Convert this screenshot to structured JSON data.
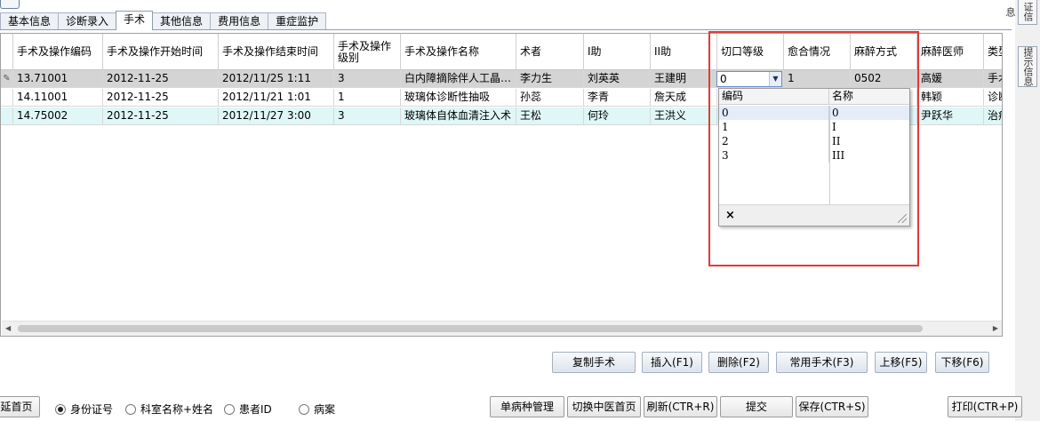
{
  "tabs": [
    {
      "label": "基本信息"
    },
    {
      "label": "诊断录入"
    },
    {
      "label": "手术",
      "active": true
    },
    {
      "label": "其他信息"
    },
    {
      "label": "费用信息"
    },
    {
      "label": "重症监护"
    }
  ],
  "side_tabs": [
    "证信息",
    "提示信息",
    "提示信息"
  ],
  "grid": {
    "columns": [
      "手术及操作编码",
      "手术及操作开始时间",
      "手术及操作结束时间",
      "手术及操作级别",
      "手术及操作名称",
      "术者",
      "I助",
      "II助",
      "切口等级",
      "愈合情况",
      "麻醉方式",
      "麻醉医师",
      "类型"
    ],
    "rows": [
      {
        "cells": [
          "13.71001",
          "2012-11-25",
          "2012/11/25 1:11",
          "3",
          "白内障摘除伴人工晶…",
          "李力生",
          "刘英英",
          "王建明",
          "0",
          "1",
          "0502",
          "高媛",
          "手术"
        ],
        "editing": true
      },
      {
        "cells": [
          "14.11001",
          "2012-11-25",
          "2012/11/21 1:01",
          "1",
          "玻璃体诊断性抽吸",
          "孙蕊",
          "李青",
          "詹天成",
          "",
          "",
          "",
          "韩颖",
          "诊断"
        ]
      },
      {
        "cells": [
          "14.75002",
          "2012-11-25",
          "2012/11/27 3:00",
          "3",
          "玻璃体自体血清注入术",
          "王松",
          "何玲",
          "王洪义",
          "",
          "",
          "",
          "尹跃华",
          "治疗"
        ]
      }
    ]
  },
  "editor": {
    "value": "0"
  },
  "dropdown": {
    "headers": [
      "编码",
      "名称"
    ],
    "items": [
      {
        "code": "0",
        "name": "0"
      },
      {
        "code": "1",
        "name": "I"
      },
      {
        "code": "2",
        "name": "II"
      },
      {
        "code": "3",
        "name": "III"
      }
    ],
    "close": "×"
  },
  "actions": {
    "copy": "复制手术",
    "insert": "插入(F1)",
    "delete": "删除(F2)",
    "common": "常用手术(F3)",
    "up": "上移(F5)",
    "down": "下移(F6)"
  },
  "bottom": {
    "home": "延首页",
    "radios": [
      {
        "label": "身份证号",
        "checked": true
      },
      {
        "label": "科室名称+姓名",
        "checked": false
      },
      {
        "label": "患者ID",
        "checked": false
      },
      {
        "label": "病案",
        "checked": false
      }
    ],
    "single_disease": "单病种管理",
    "switch_tcm": "切换中医首页",
    "refresh": "刷新(CTR+R)",
    "submit": "提交",
    "save": "保存(CTR+S)",
    "print": "打印(CTR+P)"
  }
}
